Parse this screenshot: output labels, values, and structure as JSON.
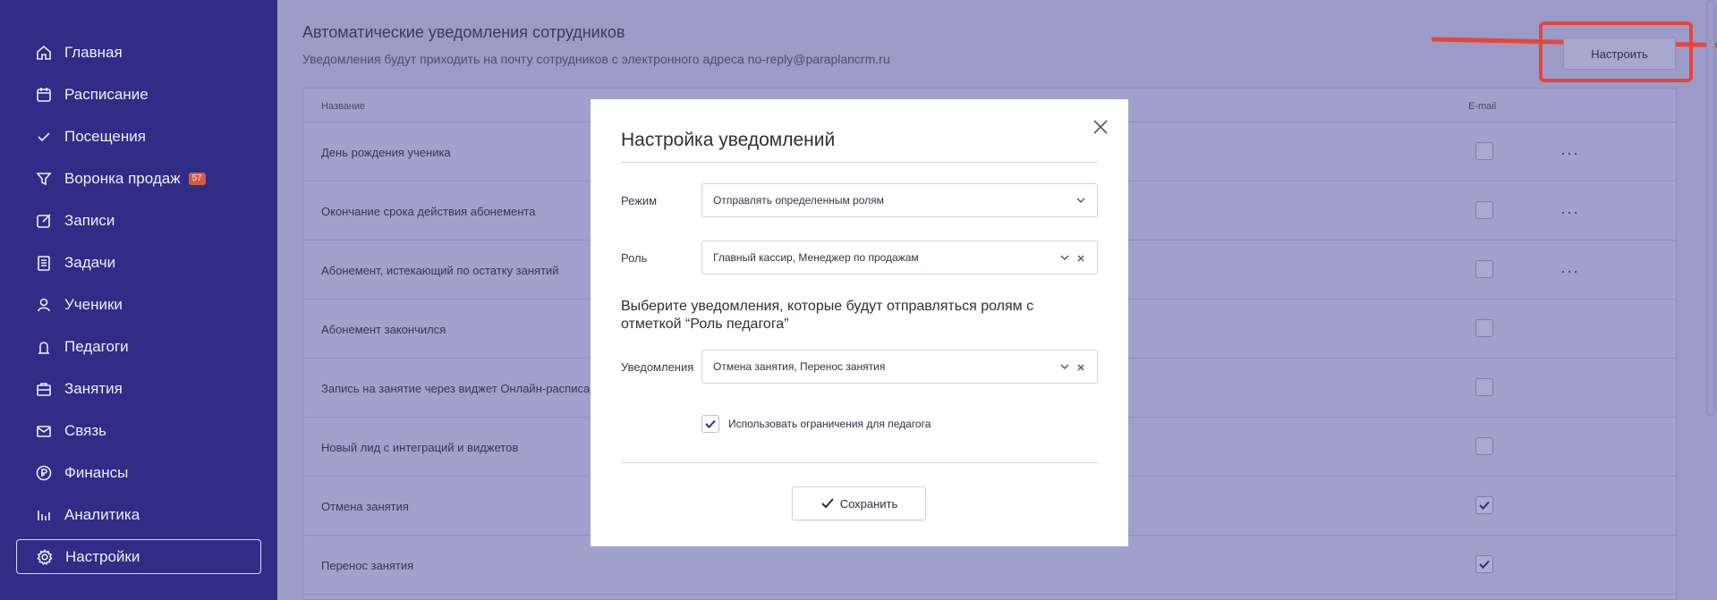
{
  "sidebar": {
    "items": [
      {
        "label": "Главная",
        "icon": "home-icon"
      },
      {
        "label": "Расписание",
        "icon": "calendar-icon"
      },
      {
        "label": "Посещения",
        "icon": "check-icon"
      },
      {
        "label": "Воронка продаж",
        "icon": "funnel-icon",
        "badge": "57"
      },
      {
        "label": "Записи",
        "icon": "edit-icon"
      },
      {
        "label": "Задачи",
        "icon": "tasks-icon"
      },
      {
        "label": "Ученики",
        "icon": "user-icon"
      },
      {
        "label": "Педагоги",
        "icon": "teacher-icon"
      },
      {
        "label": "Занятия",
        "icon": "briefcase-icon"
      },
      {
        "label": "Связь",
        "icon": "mail-icon"
      },
      {
        "label": "Финансы",
        "icon": "ruble-icon"
      },
      {
        "label": "Аналитика",
        "icon": "chart-icon"
      },
      {
        "label": "Настройки",
        "icon": "gear-icon",
        "active": true
      }
    ]
  },
  "page": {
    "title": "Автоматические уведомления сотрудников",
    "subtitle": "Уведомления будут приходить на почту сотрудников с электронного адреса no-reply@paraplancrm.ru",
    "configure_label": "Настроить"
  },
  "table": {
    "headers": {
      "name": "Название",
      "email": "E-mail"
    },
    "rows": [
      {
        "name": "День рождения ученика",
        "email": false,
        "menu": true
      },
      {
        "name": "Окончание срока действия абонемента",
        "email": false,
        "menu": true
      },
      {
        "name": "Абонемент, истекающий по остатку занятий",
        "email": false,
        "menu": true
      },
      {
        "name": "Абонемент закончился",
        "email": false,
        "menu": false
      },
      {
        "name": "Запись на занятие через виджет Онлайн-расписания",
        "email": false,
        "menu": false
      },
      {
        "name": "Новый лид с интеграций и виджетов",
        "email": false,
        "menu": false
      },
      {
        "name": "Отмена занятия",
        "email": true,
        "menu": false
      },
      {
        "name": "Перенос занятия",
        "email": true,
        "menu": false
      }
    ]
  },
  "modal": {
    "title": "Настройка уведомлений",
    "mode_label": "Режим",
    "mode_value": "Отправлять определенным ролям",
    "role_label": "Роль",
    "role_value": "Главный кассир, Менеджер по продажам",
    "section_text": "Выберите уведомления, которые будут отправляться ролям с отметкой “Роль педагога”",
    "notifications_label": "Уведомления",
    "notifications_value": "Отмена занятия, Перенос занятия",
    "restriction_label": "Использовать ограничения для педагога",
    "restriction_checked": true,
    "save_label": "Сохранить"
  },
  "colors": {
    "sidebar_bg": "#2f2d86",
    "accent_red": "#e8453a",
    "badge": "#d65b45"
  }
}
